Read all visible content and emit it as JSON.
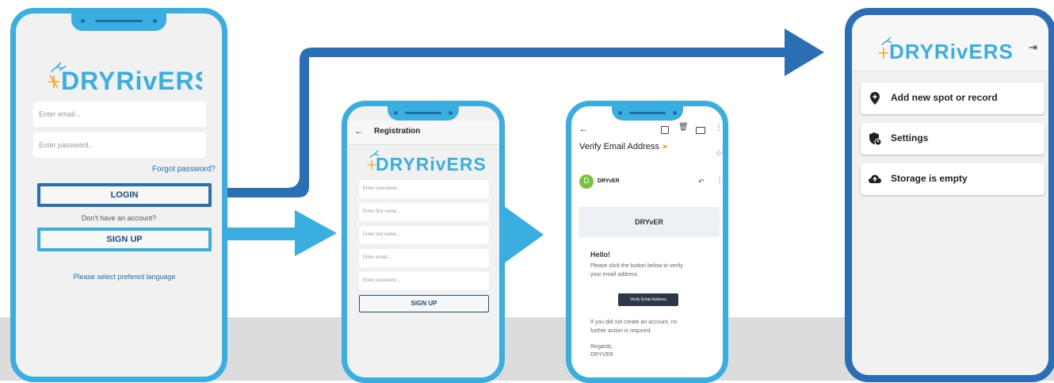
{
  "brand": {
    "logo_text": "DRYRivERS"
  },
  "login_screen": {
    "email_placeholder": "Enter email...",
    "password_placeholder": "Enter password...",
    "forgot_password": "Forgot password?",
    "login_button": "LOGIN",
    "no_account_text": "Don't have an account?",
    "signup_button": "SIGN UP",
    "language_link": "Please select prefered language"
  },
  "registration_screen": {
    "title": "Registration",
    "fields": [
      "Enter username...",
      "Enter first name...",
      "Enter last name...",
      "Enter email...",
      "Enter password..."
    ],
    "signup_button": "SIGN UP"
  },
  "email_screen": {
    "subject": "Verify Email Address",
    "sender_initial": "D",
    "sender_name": "DRYvER",
    "banner_title": "DRYvER",
    "greeting": "Hello!",
    "body_line1": "Please click the button below to verify",
    "body_line2": "your email address.",
    "verify_button": "Verify Email Address",
    "footer_line1": "If you did not create an account, no",
    "footer_line2": "further action is required.",
    "regards": "Regards,",
    "signature": "DRYVER"
  },
  "home_screen": {
    "menu": [
      {
        "label": "Add new spot or record",
        "icon": "map-pin-plus-icon"
      },
      {
        "label": "Settings",
        "icon": "shield-user-icon"
      },
      {
        "label": "Storage is empty",
        "icon": "cloud-upload-icon"
      }
    ],
    "logout_icon": "logout-icon"
  },
  "colors": {
    "frame": "#3aaee0",
    "arrow_dark": "#2a6fb6",
    "arrow_light": "#3aaee0",
    "accent_blue": "#1e4f80",
    "logo_blue": "#3aaee0",
    "logo_orange": "#f5a623"
  }
}
